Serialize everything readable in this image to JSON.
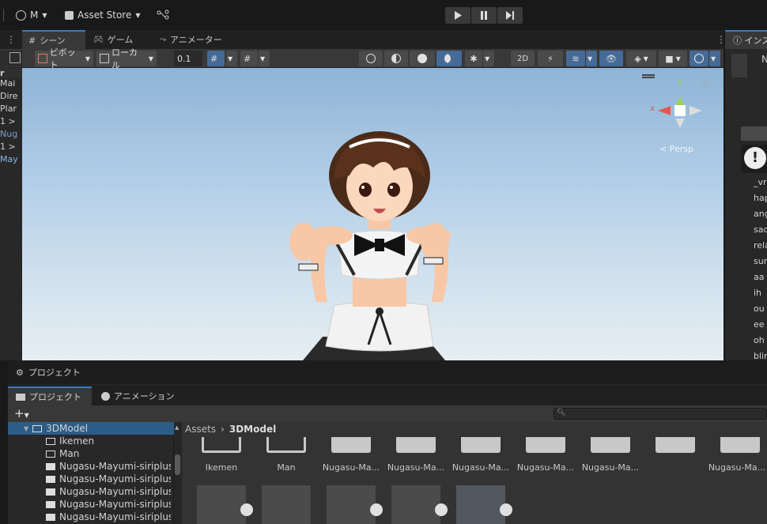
{
  "topbar": {
    "account": "M",
    "asset_store": "Asset Store"
  },
  "tabs": [
    {
      "label": "シーン"
    },
    {
      "label": "ゲーム"
    },
    {
      "label": "アニメーター"
    }
  ],
  "scene_toolbar": {
    "pivot": "ピボット",
    "local": "ローカル",
    "snap_value": "0.1"
  },
  "gizmo": {
    "y": "y",
    "x": "x",
    "persp": "< Persp"
  },
  "hierarchy": {
    "rows": [
      "r",
      "Mai",
      "Dire",
      "Plar",
      "1 >",
      "Nug",
      "1 >",
      "May"
    ]
  },
  "inspector": {
    "tab": "インス",
    "name_initial": "N",
    "labels": [
      "_vr",
      "hap",
      "ang",
      "sad",
      "rela",
      "surp",
      "aa",
      "ih",
      "ou",
      "ee",
      "oh",
      "blin"
    ]
  },
  "project": {
    "window_title": "プロジェクト",
    "tabs": [
      {
        "label": "プロジェクト"
      },
      {
        "label": "アニメーション"
      }
    ],
    "breadcrumb": {
      "root": "Assets",
      "current": "3DModel"
    },
    "tree": [
      "3DModel",
      "Ikemen",
      "Man",
      "Nugasu-Mayumi-siriplus2",
      "Nugasu-Mayumi-siriplus2",
      "Nugasu-Mayumi-siriplus2",
      "Nugasu-Mayumi-siriplus2",
      "Nugasu-Mayumi-siriplus2"
    ],
    "assets": [
      "Ikemen",
      "Man",
      "Nugasu-Ma...",
      "Nugasu-Ma...",
      "Nugasu-Ma...",
      "Nugasu-Ma...",
      "Nugasu-Ma...",
      "Nugasu-Ma..."
    ]
  },
  "colors": {
    "accent": "#3a79bb",
    "toggle_on": "#466a96",
    "sky_top": "#8fb4d7",
    "sky_bottom": "#e6eef2"
  }
}
